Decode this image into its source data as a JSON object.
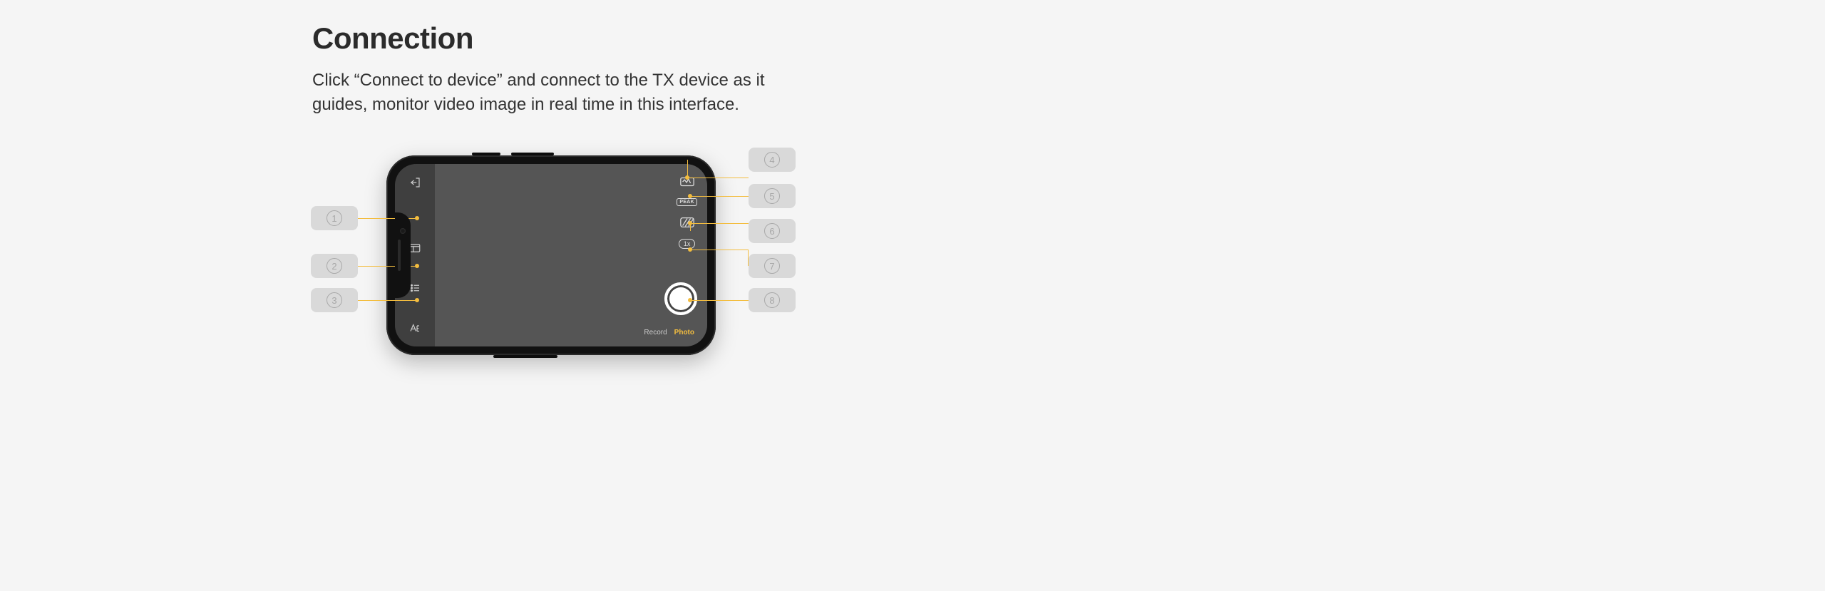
{
  "heading": "Connection",
  "body": "Click “Connect to device” and connect to the TX device as it guides, monitor video image in real time in this interface.",
  "phone": {
    "left_icons": {
      "exit": "exit-icon",
      "panel": "panel-icon",
      "settings_list": "settings-list-icon",
      "text_adjust": "text-adjust-icon"
    },
    "right_icons": {
      "waveform": "waveform-icon",
      "peak_label": "PEAK",
      "zebra": "zebra-icon",
      "zoom_label": "1x"
    },
    "modes": {
      "record": "Record",
      "photo": "Photo"
    }
  },
  "callouts": {
    "left": [
      "1",
      "2",
      "3"
    ],
    "right": [
      "4",
      "5",
      "6",
      "7",
      "8"
    ]
  },
  "colors": {
    "accent": "#f3bd3f",
    "pill": "#d9d9d9",
    "page_bg": "#f5f5f5"
  }
}
